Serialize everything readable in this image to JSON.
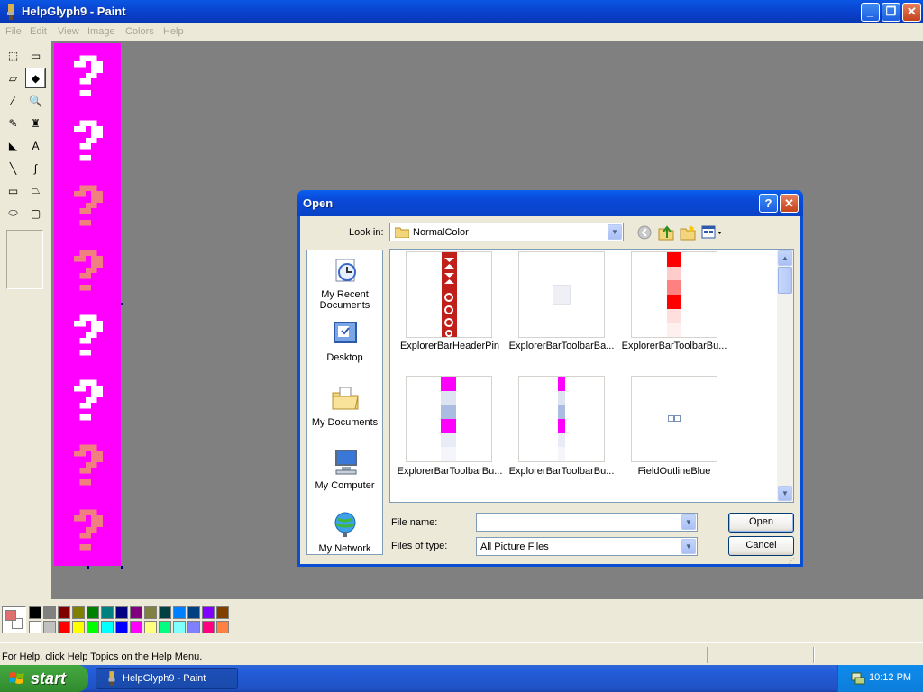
{
  "window": {
    "title": "HelpGlyph9 - Paint",
    "minimize": "_",
    "maximize": "❐",
    "close": "✕"
  },
  "menu": [
    "File",
    "Edit",
    "View",
    "Image",
    "Colors",
    "Help"
  ],
  "tools": [
    {
      "name": "free-form-select-icon",
      "glyph": "⬚"
    },
    {
      "name": "rect-select-icon",
      "glyph": "▭"
    },
    {
      "name": "eraser-icon",
      "glyph": "▱"
    },
    {
      "name": "fill-bucket-icon",
      "glyph": "◆"
    },
    {
      "name": "eyedropper-icon",
      "glyph": "⁄"
    },
    {
      "name": "magnifier-icon",
      "glyph": "🔍"
    },
    {
      "name": "pencil-icon",
      "glyph": "✎"
    },
    {
      "name": "brush-icon",
      "glyph": "♜"
    },
    {
      "name": "airbrush-icon",
      "glyph": "◣"
    },
    {
      "name": "text-tool-icon",
      "glyph": "A"
    },
    {
      "name": "line-icon",
      "glyph": "╲"
    },
    {
      "name": "curve-icon",
      "glyph": "∫"
    },
    {
      "name": "rectangle-icon",
      "glyph": "▭"
    },
    {
      "name": "polygon-icon",
      "glyph": "⏢"
    },
    {
      "name": "ellipse-icon",
      "glyph": "⬭"
    },
    {
      "name": "rounded-rect-icon",
      "glyph": "▢"
    }
  ],
  "palette": {
    "row1": [
      "#000000",
      "#808080",
      "#800000",
      "#808000",
      "#008000",
      "#008080",
      "#000080",
      "#800080",
      "#808040",
      "#004040",
      "#0080ff",
      "#004080",
      "#8000ff",
      "#804000"
    ],
    "row2": [
      "#ffffff",
      "#c0c0c0",
      "#ff0000",
      "#ffff00",
      "#00ff00",
      "#00ffff",
      "#0000ff",
      "#ff00ff",
      "#ffff80",
      "#00ff80",
      "#80ffff",
      "#8080ff",
      "#ff0080",
      "#ff8040"
    ],
    "foreground": "#e07070",
    "background": "#ffffff"
  },
  "canvas": {
    "background": "#ff00ff",
    "glyph_colors": [
      "#ffffff",
      "#ffffff",
      "#f08080",
      "#f08080",
      "#ffffff",
      "#ffffff",
      "#f08080",
      "#f08080"
    ]
  },
  "status": {
    "text": "For Help, click Help Topics on the Help Menu."
  },
  "taskbar": {
    "start": "start",
    "task": "HelpGlyph9 - Paint",
    "clock": "10:12 PM"
  },
  "dialog": {
    "title": "Open",
    "help": "?",
    "close": "✕",
    "look_in_label": "Look in:",
    "look_in_value": "NormalColor",
    "places": [
      "My Recent Documents",
      "Desktop",
      "My Documents",
      "My Computer",
      "My Network"
    ],
    "files": [
      {
        "name": "ExplorerBarHeaderPin",
        "thumb": "header-pin"
      },
      {
        "name": "ExplorerBarToolbarBa...",
        "thumb": "small-square"
      },
      {
        "name": "ExplorerBarToolbarBu...",
        "thumb": "red-strip"
      },
      {
        "name": "ExplorerBarToolbarBu...",
        "thumb": "magenta-strip-wide"
      },
      {
        "name": "ExplorerBarToolbarBu...",
        "thumb": "magenta-strip-narrow"
      },
      {
        "name": "FieldOutlineBlue",
        "thumb": "outline-boxes"
      }
    ],
    "file_name_label": "File name:",
    "file_name_value": "",
    "files_of_type_label": "Files of type:",
    "files_of_type_value": "All Picture Files",
    "open_label": "Open",
    "cancel_label": "Cancel"
  }
}
